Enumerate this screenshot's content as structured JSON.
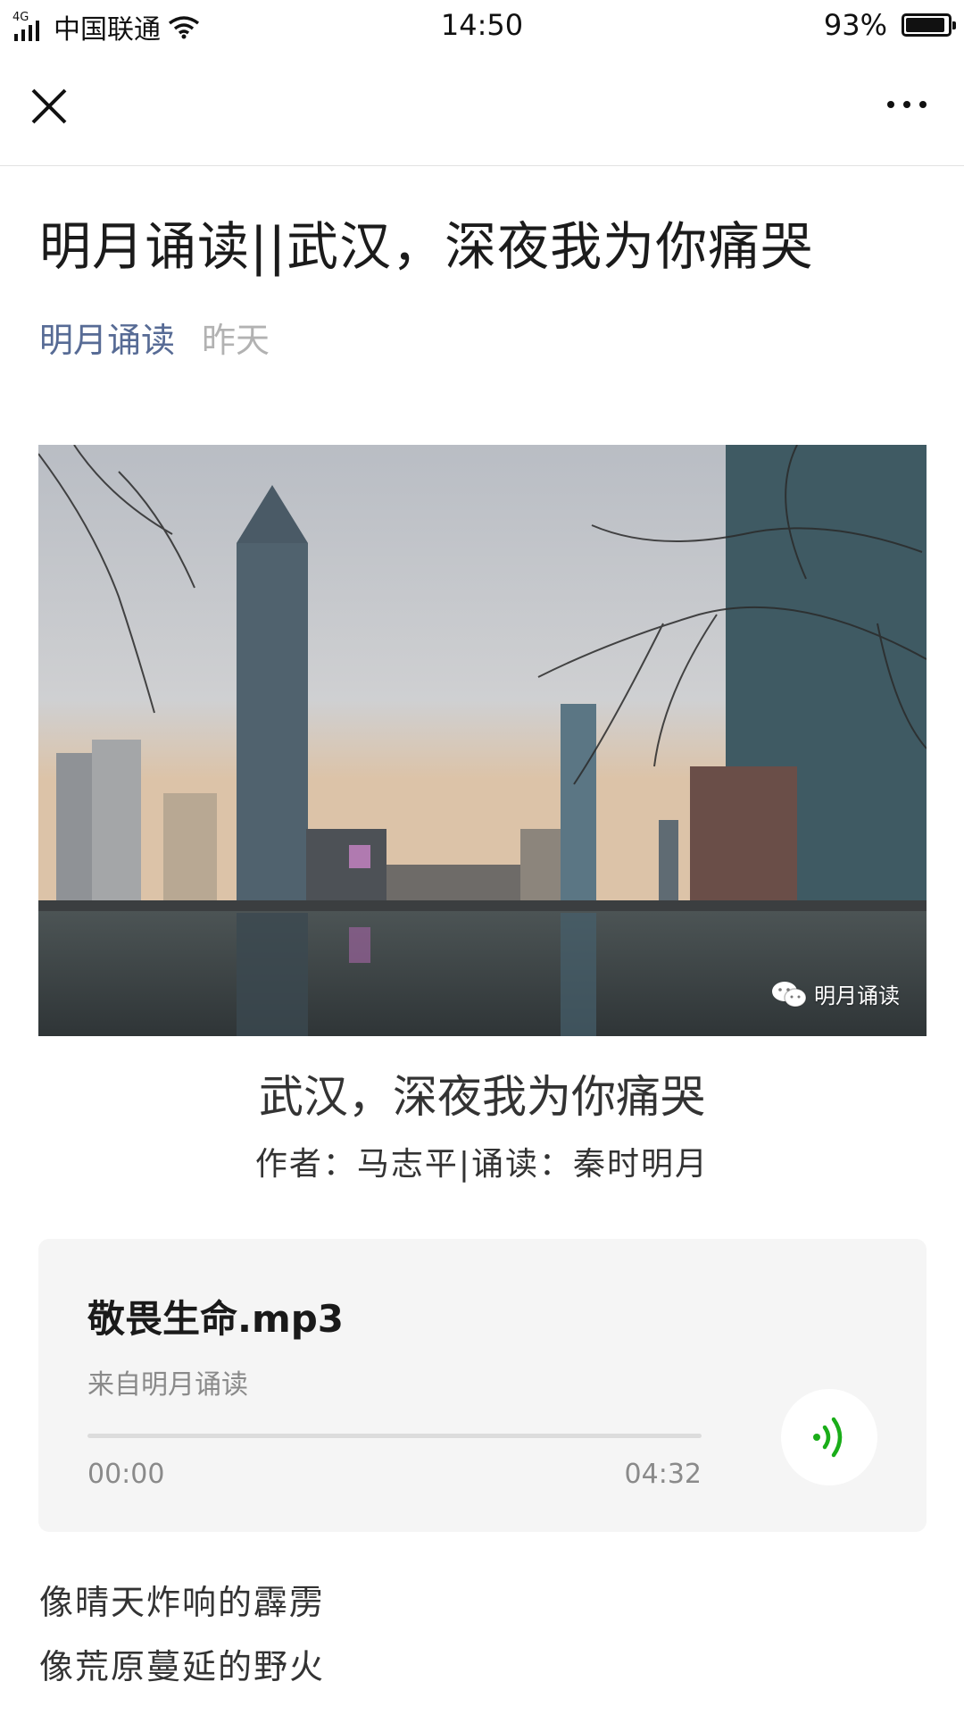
{
  "status_bar": {
    "network": "4G",
    "carrier": "中国联通",
    "time": "14:50",
    "battery": "93%",
    "battery_level": 0.93
  },
  "navbar": {
    "close_icon": "close-icon",
    "more_icon": "more-dots-icon"
  },
  "article": {
    "title": "明月诵读||武汉，深夜我为你痛哭",
    "author": "明月诵读",
    "date": "昨天",
    "image_watermark": "明月诵读",
    "poem_title": "武汉，深夜我为你痛哭",
    "poem_byline": "作者：马志平|诵读：秦时明月"
  },
  "audio": {
    "name": "敬畏生命.mp3",
    "source": "来自明月诵读",
    "current_time": "00:00",
    "total_time": "04:32",
    "progress": 0,
    "play_icon": "audio-wave-icon",
    "accent_color": "#1aad19"
  },
  "body": {
    "lines": [
      "像晴天炸响的霹雳",
      "像荒原蔓延的野火"
    ]
  },
  "colors": {
    "link": "#576b95",
    "muted": "#b2b2b2"
  }
}
